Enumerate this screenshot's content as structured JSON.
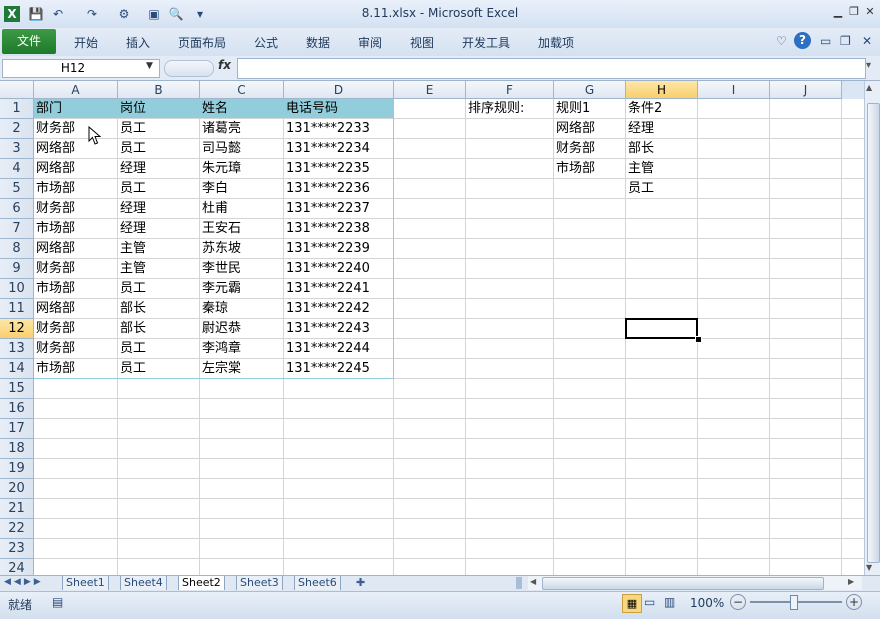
{
  "window": {
    "title": "8.11.xlsx - Microsoft Excel",
    "icons": [
      "excel-icon",
      "save-icon",
      "undo-icon",
      "redo-icon",
      "format-icon",
      "camera-icon",
      "print-preview-icon",
      "customize-icon"
    ]
  },
  "ribbon": {
    "file_tab": "文件",
    "tabs": [
      "开始",
      "插入",
      "页面布局",
      "公式",
      "数据",
      "审阅",
      "视图",
      "开发工具",
      "加载项"
    ]
  },
  "formula_bar": {
    "name_box": "H12",
    "fx_label": "fx",
    "value": ""
  },
  "columns": [
    "A",
    "B",
    "C",
    "D",
    "E",
    "F",
    "G",
    "H",
    "I",
    "J"
  ],
  "selected_column": "H",
  "rows": [
    "1",
    "2",
    "3",
    "4",
    "5",
    "6",
    "7",
    "8",
    "9",
    "10",
    "11",
    "12",
    "13",
    "14",
    "15",
    "16",
    "17",
    "18",
    "19",
    "20",
    "21",
    "22",
    "23",
    "24"
  ],
  "selected_row": "12",
  "table": {
    "header": [
      "部门",
      "岗位",
      "姓名",
      "电话号码"
    ],
    "rows": [
      [
        "财务部",
        "员工",
        "诸葛亮",
        "131****2233"
      ],
      [
        "网络部",
        "员工",
        "司马懿",
        "131****2234"
      ],
      [
        "网络部",
        "经理",
        "朱元璋",
        "131****2235"
      ],
      [
        "市场部",
        "员工",
        "李白",
        "131****2236"
      ],
      [
        "财务部",
        "经理",
        "杜甫",
        "131****2237"
      ],
      [
        "市场部",
        "经理",
        "王安石",
        "131****2238"
      ],
      [
        "网络部",
        "主管",
        "苏东坡",
        "131****2239"
      ],
      [
        "财务部",
        "主管",
        "李世民",
        "131****2240"
      ],
      [
        "市场部",
        "员工",
        "李元霸",
        "131****2241"
      ],
      [
        "网络部",
        "部长",
        "秦琼",
        "131****2242"
      ],
      [
        "财务部",
        "部长",
        "尉迟恭",
        "131****2243"
      ],
      [
        "财务部",
        "员工",
        "李鸿章",
        "131****2244"
      ],
      [
        "市场部",
        "员工",
        "左宗棠",
        "131****2245"
      ]
    ],
    "header_color": "#92cddc"
  },
  "sort_rules": {
    "label": "排序规则:",
    "rule1_header": "规则1",
    "rule1": [
      "网络部",
      "财务部",
      "市场部"
    ],
    "rule2_header": "条件2",
    "rule2": [
      "经理",
      "部长",
      "主管",
      "员工"
    ]
  },
  "sheets": [
    "Sheet1",
    "Sheet4",
    "Sheet2",
    "Sheet3",
    "Sheet6"
  ],
  "active_sheet": "Sheet2",
  "status": {
    "ready": "就绪",
    "zoom": "100%"
  }
}
